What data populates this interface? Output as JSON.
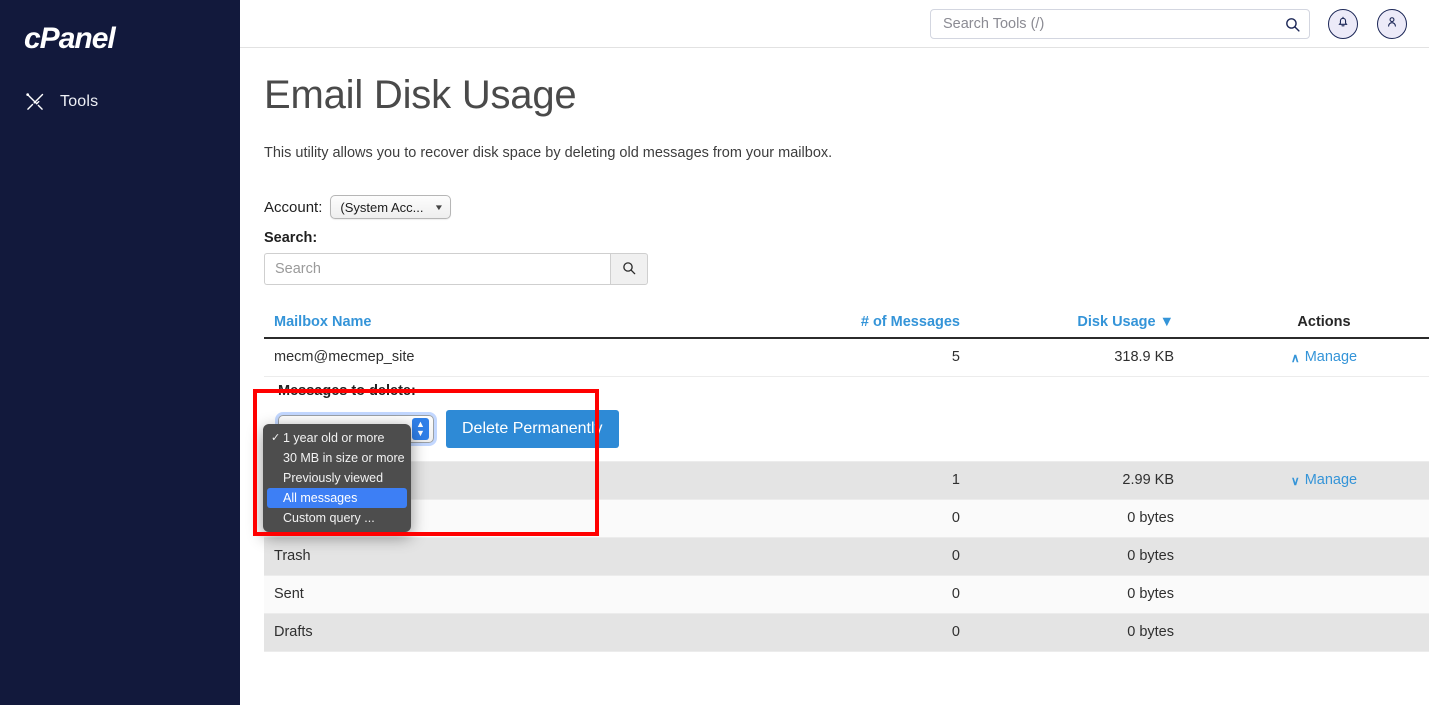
{
  "sidebar": {
    "brand": "cPanel",
    "items": [
      {
        "label": "Tools",
        "icon": "tools-icon"
      }
    ]
  },
  "topbar": {
    "search": {
      "placeholder": "Search Tools (/)",
      "value": "",
      "icon": "search-icon"
    },
    "notifications_icon": "bell-icon",
    "user_icon": "user-icon"
  },
  "page": {
    "title": "Email Disk Usage",
    "description": "This utility allows you to recover disk space by deleting old messages from your mailbox."
  },
  "account": {
    "label": "Account:",
    "selected": "(System Acc...",
    "caret": "▼"
  },
  "search": {
    "label": "Search:",
    "placeholder": "Search",
    "value": "",
    "button_icon": "search-icon"
  },
  "table": {
    "headers": {
      "name": "Mailbox Name",
      "messages": "# of Messages",
      "usage": "Disk Usage",
      "usage_sort": "▼",
      "actions": "Actions"
    },
    "rows": [
      {
        "name": "mecm@mecmep_site",
        "messages": "5",
        "usage": "318.9 KB",
        "action": "Manage",
        "chevron": "∧"
      },
      {
        "name": "",
        "messages": "1",
        "usage": "2.99 KB",
        "action": "Manage",
        "chevron": "∨"
      },
      {
        "name": "",
        "messages": "0",
        "usage": "0 bytes",
        "action": "",
        "chevron": ""
      },
      {
        "name": "Trash",
        "messages": "0",
        "usage": "0 bytes",
        "action": "",
        "chevron": ""
      },
      {
        "name": "Sent",
        "messages": "0",
        "usage": "0 bytes",
        "action": "",
        "chevron": ""
      },
      {
        "name": "Drafts",
        "messages": "0",
        "usage": "0 bytes",
        "action": "",
        "chevron": ""
      }
    ]
  },
  "manage_panel": {
    "label": "Messages to delete:",
    "delete_button": "Delete Permanently",
    "stepper_up": "▲",
    "stepper_down": "▼"
  },
  "dropdown": {
    "options": [
      {
        "label": "1 year old or more",
        "checked": true,
        "highlighted": false
      },
      {
        "label": "30 MB in size or more",
        "checked": false,
        "highlighted": false
      },
      {
        "label": "Previously viewed",
        "checked": false,
        "highlighted": false
      },
      {
        "label": "All messages",
        "checked": false,
        "highlighted": true
      },
      {
        "label": "Custom query ...",
        "checked": false,
        "highlighted": false
      }
    ],
    "check_glyph": "✓"
  },
  "annotation": {
    "color": "#ff0000"
  }
}
